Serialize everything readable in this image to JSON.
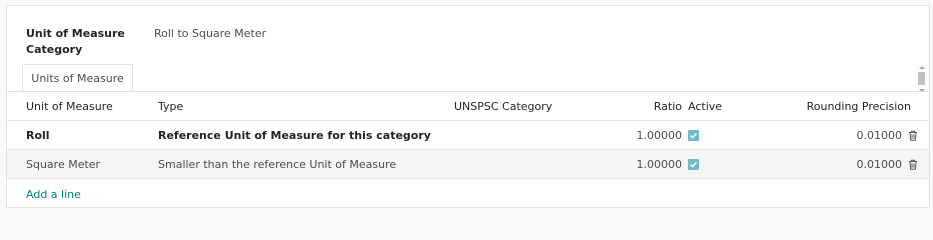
{
  "form": {
    "category_label": "Unit of Measure Category",
    "category_value": "Roll to Square Meter"
  },
  "tabs": [
    {
      "label": "Units of Measure",
      "active": true
    }
  ],
  "table": {
    "columns": {
      "uom": "Unit of Measure",
      "type": "Type",
      "unspsc": "UNSPSC Category",
      "ratio": "Ratio",
      "active": "Active",
      "rounding": "Rounding Precision"
    },
    "rows": [
      {
        "uom": "Roll",
        "type": "Reference Unit of Measure for this category",
        "unspsc": "",
        "ratio": "1.00000",
        "active": true,
        "rounding": "0.01000",
        "bold": true
      },
      {
        "uom": "Square Meter",
        "type": "Smaller than the reference Unit of Measure",
        "unspsc": "",
        "ratio": "1.00000",
        "active": true,
        "rounding": "0.01000",
        "bold": false
      }
    ],
    "add_line": "Add a line"
  },
  "icons": {
    "delete": "trash-icon",
    "checked": "checkbox-checked-icon"
  },
  "colors": {
    "checkbox": "#71b9c4",
    "link": "#017e84"
  }
}
